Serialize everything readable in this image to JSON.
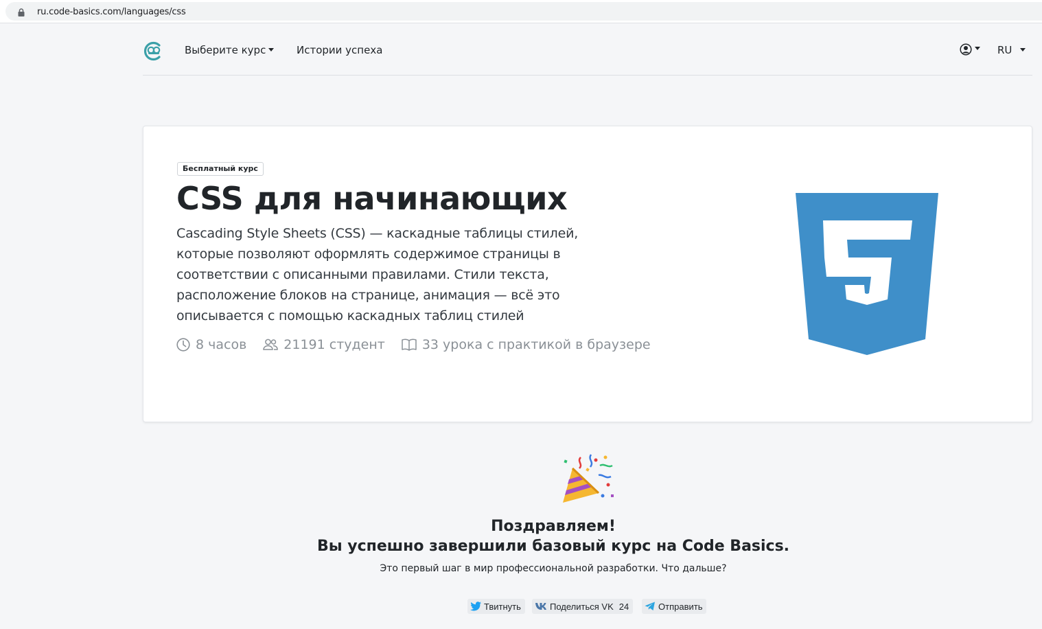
{
  "browser": {
    "url": "ru.code-basics.com/languages/css"
  },
  "nav": {
    "courses_label": "Выберите курс",
    "stories_label": "Истории успеха",
    "lang_label": "RU"
  },
  "course": {
    "badge": "Бесплатный курс",
    "title": "CSS для начинающих",
    "description": "Cascading Style Sheets (CSS) — каскадные таблицы стилей, которые позволяют оформлять содержимое страницы в соответствии с описанными правилами. Стили текста, расположение блоков на странице, анимация — всё это описывается с помощью каскадных таблиц стилей",
    "duration": "8 часов",
    "students": "21191 студент",
    "lessons": "33 урока с практикой в браузере",
    "logo_color": "#3f8fc9"
  },
  "congrats": {
    "heading": "Поздравляем!",
    "subheading": "Вы успешно завершили базовый курс на Code Basics.",
    "text": "Это первый шаг в мир профессиональной разработки. Что дальше?"
  },
  "share": {
    "twitter_label": "Твитнуть",
    "vk_label": "Поделиться VK",
    "vk_count": "24",
    "telegram_label": "Отправить"
  },
  "colors": {
    "accent": "#3ba0a8",
    "css_blue": "#3f8fc9",
    "twitter": "#1da1f2",
    "vk": "#4a76a8",
    "telegram": "#2ca5e0"
  },
  "icons": [
    "lock-icon",
    "code-basics-logo",
    "user-icon",
    "clock-icon",
    "users-icon",
    "book-icon",
    "css3-logo",
    "party-popper-icon",
    "twitter-icon",
    "vk-icon",
    "telegram-icon"
  ]
}
